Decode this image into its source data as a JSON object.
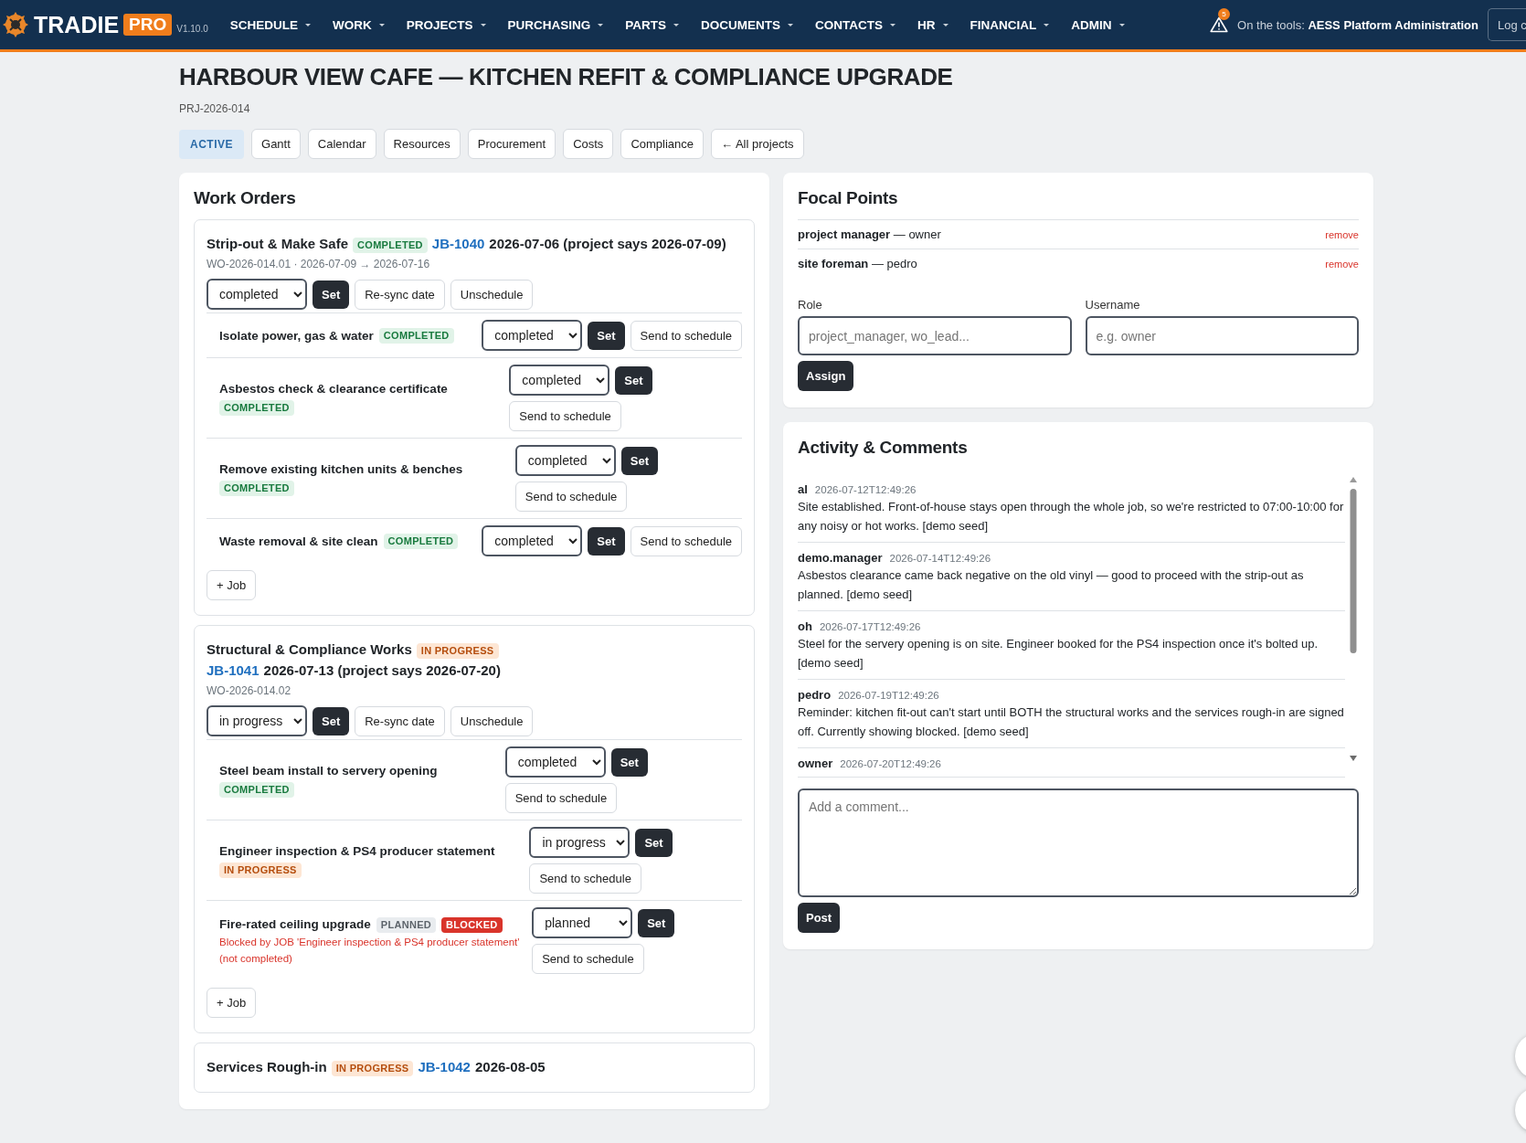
{
  "nav": {
    "brand": "TRADIE",
    "badge": "PRO",
    "version": "V1.10.0",
    "menu": [
      "SCHEDULE",
      "WORK",
      "PROJECTS",
      "PURCHASING",
      "PARTS",
      "DOCUMENTS",
      "CONTACTS",
      "HR",
      "FINANCIAL",
      "ADMIN"
    ],
    "alert_count": "5",
    "user_text": "On the tools: **AESS Platform Administration**",
    "logout": "Log c"
  },
  "project": {
    "title": "HARBOUR VIEW CAFE — KITCHEN REFIT & COMPLIANCE UPGRADE",
    "code": "PRJ-2026-014",
    "state": "ACTIVE",
    "tabs": [
      "Gantt",
      "Calendar",
      "Resources",
      "Procurement",
      "Costs",
      "Compliance",
      "← All projects"
    ]
  },
  "work_orders": {
    "title": "Work Orders",
    "items": [
      {
        "title": "Strip-out & Make Safe",
        "badge": {
          "text": "COMPLETED",
          "kind": "completed"
        },
        "job": "JB-1040",
        "date_note": "2026-07-06 (project says 2026-07-09)",
        "meta": "WO-2026-014.01 · 2026-07-09 → 2026-07-16",
        "select": "completed",
        "set": "Set",
        "resync": "Re-sync date",
        "unschedule": "Unschedule",
        "add_job": "+ Job",
        "jobs": [
          {
            "title": "Isolate power, gas & water",
            "badges": [
              {
                "text": "COMPLETED",
                "kind": "completed"
              }
            ],
            "select": "completed",
            "set": "Set",
            "send": "Send to schedule"
          },
          {
            "title": "Asbestos check & clearance certificate",
            "badges": [
              {
                "text": "COMPLETED",
                "kind": "completed"
              }
            ],
            "select": "completed",
            "set": "Set",
            "send": "Send to schedule"
          },
          {
            "title": "Remove existing kitchen units & benches",
            "badges": [
              {
                "text": "COMPLETED",
                "kind": "completed"
              }
            ],
            "select": "completed",
            "set": "Set",
            "send": "Send to schedule"
          },
          {
            "title": "Waste removal & site clean",
            "badges": [
              {
                "text": "COMPLETED",
                "kind": "completed"
              }
            ],
            "select": "completed",
            "set": "Set",
            "send": "Send to schedule"
          }
        ]
      },
      {
        "title": "Structural & Compliance Works",
        "badge": {
          "text": "IN PROGRESS",
          "kind": "progress"
        },
        "job": "JB-1041",
        "date_note": "2026-07-13 (project says 2026-07-20)",
        "meta": "WO-2026-014.02",
        "select": "in progress",
        "set": "Set",
        "resync": "Re-sync date",
        "unschedule": "Unschedule",
        "add_job": "+ Job",
        "jobs": [
          {
            "title": "Steel beam install to servery opening",
            "badges": [
              {
                "text": "COMPLETED",
                "kind": "completed"
              }
            ],
            "select": "completed",
            "set": "Set",
            "send": "Send to schedule"
          },
          {
            "title": "Engineer inspection & PS4 producer statement",
            "badges": [
              {
                "text": "IN PROGRESS",
                "kind": "progress"
              }
            ],
            "select": "in progress",
            "set": "Set",
            "send": "Send to schedule"
          },
          {
            "title": "Fire-rated ceiling upgrade",
            "badges": [
              {
                "text": "PLANNED",
                "kind": "planned"
              },
              {
                "text": "BLOCKED",
                "kind": "blocked"
              }
            ],
            "note": "Blocked by JOB 'Engineer inspection & PS4 producer statement' (not completed)",
            "select": "planned",
            "set": "Set",
            "send": "Send to schedule"
          }
        ]
      },
      {
        "title": "Services Rough-in",
        "badge": {
          "text": "IN PROGRESS",
          "kind": "progress"
        },
        "job": "JB-1042",
        "date_note": "2026-08-05"
      }
    ]
  },
  "focal_points": {
    "title": "Focal Points",
    "items": [
      {
        "text": "**project manager** — owner",
        "action": "remove"
      },
      {
        "text": "**site foreman** — pedro",
        "action": "remove"
      }
    ],
    "role_label": "Role",
    "role_placeholder": "project_manager, wo_lead...",
    "username_label": "Username",
    "username_placeholder": "e.g. owner",
    "assign": "Assign"
  },
  "activity": {
    "title": "Activity & Comments",
    "comments": [
      {
        "author": "al",
        "time": "2026-07-12T12:49:26",
        "text": "Site established. Front-of-house stays open through the whole job, so we're restricted to 07:00-10:00 for any noisy or hot works. [demo seed]"
      },
      {
        "author": "demo.manager",
        "time": "2026-07-14T12:49:26",
        "text": "Asbestos clearance came back negative on the old vinyl — good to proceed with the strip-out as planned. [demo seed]"
      },
      {
        "author": "oh",
        "time": "2026-07-17T12:49:26",
        "text": "Steel for the servery opening is on site. Engineer booked for the PS4 inspection once it's bolted up. [demo seed]"
      },
      {
        "author": "pedro",
        "time": "2026-07-19T12:49:26",
        "text": "Reminder: kitchen fit-out can't start until BOTH the structural works and the services rough-in are signed off. Currently showing blocked. [demo seed]"
      },
      {
        "author": "owner",
        "time": "2026-07-20T12:49:26"
      }
    ],
    "comment_placeholder": "Add a comment...",
    "post": "Post"
  }
}
